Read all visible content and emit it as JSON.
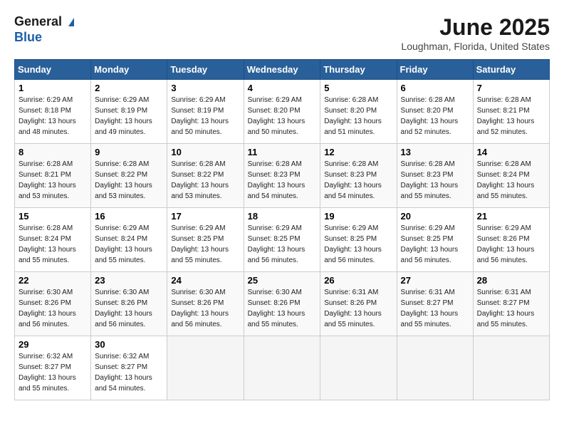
{
  "logo": {
    "line1": "General",
    "line2": "Blue"
  },
  "title": "June 2025",
  "location": "Loughman, Florida, United States",
  "headers": [
    "Sunday",
    "Monday",
    "Tuesday",
    "Wednesday",
    "Thursday",
    "Friday",
    "Saturday"
  ],
  "weeks": [
    [
      {
        "day": "1",
        "sunrise": "6:29 AM",
        "sunset": "8:18 PM",
        "daylight": "13 hours and 48 minutes."
      },
      {
        "day": "2",
        "sunrise": "6:29 AM",
        "sunset": "8:19 PM",
        "daylight": "13 hours and 49 minutes."
      },
      {
        "day": "3",
        "sunrise": "6:29 AM",
        "sunset": "8:19 PM",
        "daylight": "13 hours and 50 minutes."
      },
      {
        "day": "4",
        "sunrise": "6:29 AM",
        "sunset": "8:20 PM",
        "daylight": "13 hours and 50 minutes."
      },
      {
        "day": "5",
        "sunrise": "6:28 AM",
        "sunset": "8:20 PM",
        "daylight": "13 hours and 51 minutes."
      },
      {
        "day": "6",
        "sunrise": "6:28 AM",
        "sunset": "8:20 PM",
        "daylight": "13 hours and 52 minutes."
      },
      {
        "day": "7",
        "sunrise": "6:28 AM",
        "sunset": "8:21 PM",
        "daylight": "13 hours and 52 minutes."
      }
    ],
    [
      {
        "day": "8",
        "sunrise": "6:28 AM",
        "sunset": "8:21 PM",
        "daylight": "13 hours and 53 minutes."
      },
      {
        "day": "9",
        "sunrise": "6:28 AM",
        "sunset": "8:22 PM",
        "daylight": "13 hours and 53 minutes."
      },
      {
        "day": "10",
        "sunrise": "6:28 AM",
        "sunset": "8:22 PM",
        "daylight": "13 hours and 53 minutes."
      },
      {
        "day": "11",
        "sunrise": "6:28 AM",
        "sunset": "8:23 PM",
        "daylight": "13 hours and 54 minutes."
      },
      {
        "day": "12",
        "sunrise": "6:28 AM",
        "sunset": "8:23 PM",
        "daylight": "13 hours and 54 minutes."
      },
      {
        "day": "13",
        "sunrise": "6:28 AM",
        "sunset": "8:23 PM",
        "daylight": "13 hours and 55 minutes."
      },
      {
        "day": "14",
        "sunrise": "6:28 AM",
        "sunset": "8:24 PM",
        "daylight": "13 hours and 55 minutes."
      }
    ],
    [
      {
        "day": "15",
        "sunrise": "6:28 AM",
        "sunset": "8:24 PM",
        "daylight": "13 hours and 55 minutes."
      },
      {
        "day": "16",
        "sunrise": "6:29 AM",
        "sunset": "8:24 PM",
        "daylight": "13 hours and 55 minutes."
      },
      {
        "day": "17",
        "sunrise": "6:29 AM",
        "sunset": "8:25 PM",
        "daylight": "13 hours and 55 minutes."
      },
      {
        "day": "18",
        "sunrise": "6:29 AM",
        "sunset": "8:25 PM",
        "daylight": "13 hours and 56 minutes."
      },
      {
        "day": "19",
        "sunrise": "6:29 AM",
        "sunset": "8:25 PM",
        "daylight": "13 hours and 56 minutes."
      },
      {
        "day": "20",
        "sunrise": "6:29 AM",
        "sunset": "8:25 PM",
        "daylight": "13 hours and 56 minutes."
      },
      {
        "day": "21",
        "sunrise": "6:29 AM",
        "sunset": "8:26 PM",
        "daylight": "13 hours and 56 minutes."
      }
    ],
    [
      {
        "day": "22",
        "sunrise": "6:30 AM",
        "sunset": "8:26 PM",
        "daylight": "13 hours and 56 minutes."
      },
      {
        "day": "23",
        "sunrise": "6:30 AM",
        "sunset": "8:26 PM",
        "daylight": "13 hours and 56 minutes."
      },
      {
        "day": "24",
        "sunrise": "6:30 AM",
        "sunset": "8:26 PM",
        "daylight": "13 hours and 56 minutes."
      },
      {
        "day": "25",
        "sunrise": "6:30 AM",
        "sunset": "8:26 PM",
        "daylight": "13 hours and 55 minutes."
      },
      {
        "day": "26",
        "sunrise": "6:31 AM",
        "sunset": "8:26 PM",
        "daylight": "13 hours and 55 minutes."
      },
      {
        "day": "27",
        "sunrise": "6:31 AM",
        "sunset": "8:27 PM",
        "daylight": "13 hours and 55 minutes."
      },
      {
        "day": "28",
        "sunrise": "6:31 AM",
        "sunset": "8:27 PM",
        "daylight": "13 hours and 55 minutes."
      }
    ],
    [
      {
        "day": "29",
        "sunrise": "6:32 AM",
        "sunset": "8:27 PM",
        "daylight": "13 hours and 55 minutes."
      },
      {
        "day": "30",
        "sunrise": "6:32 AM",
        "sunset": "8:27 PM",
        "daylight": "13 hours and 54 minutes."
      },
      null,
      null,
      null,
      null,
      null
    ]
  ]
}
